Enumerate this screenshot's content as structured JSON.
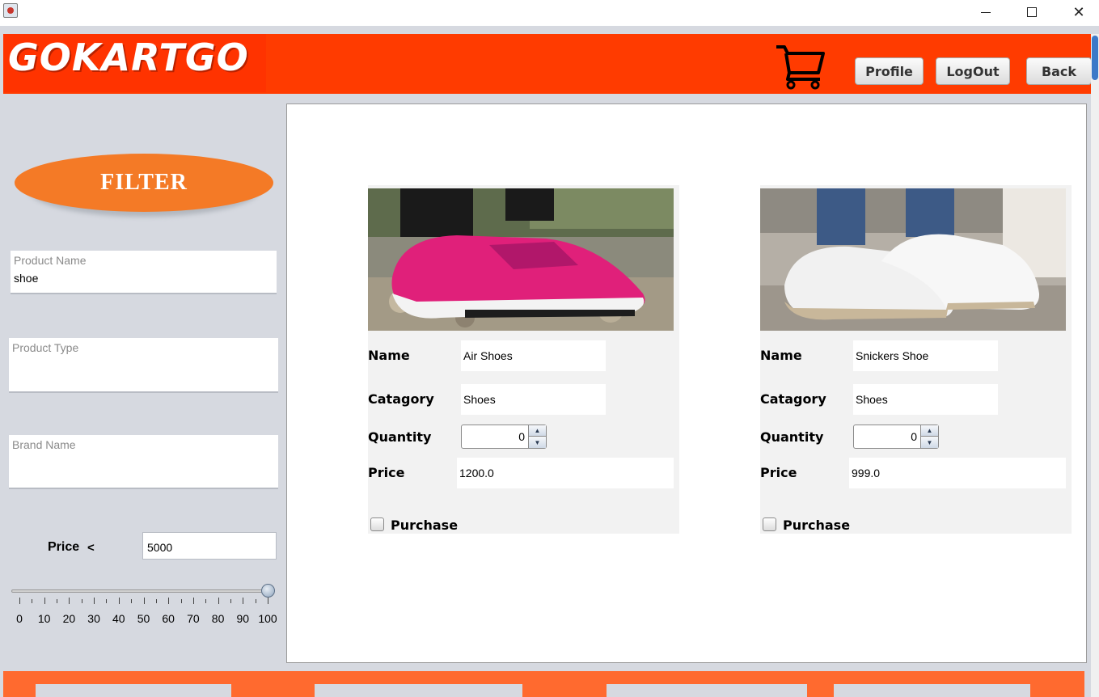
{
  "window": {
    "minimize": "",
    "maximize": "",
    "close": "✕"
  },
  "header": {
    "logo": "GOKARTGO",
    "cart_icon": "shopping-cart-icon",
    "buttons": {
      "profile": "Profile",
      "logout": "LogOut",
      "back": "Back"
    }
  },
  "sidebar": {
    "filter_label": "FILTER",
    "product_name": {
      "placeholder": "Product Name",
      "value": "shoe"
    },
    "product_type": {
      "placeholder": "Product Type",
      "value": ""
    },
    "brand_name": {
      "placeholder": "Brand Name",
      "value": ""
    },
    "price_label": "Price",
    "price_op": "<",
    "price_value": "5000",
    "slider": {
      "value": 100,
      "min": 0,
      "max": 100,
      "tick_labels": [
        "0",
        "10",
        "20",
        "30",
        "40",
        "50",
        "60",
        "70",
        "80",
        "90",
        "100"
      ]
    }
  },
  "products": [
    {
      "image": "pink-sneaker-photo",
      "name_label": "Name",
      "name": "Air Shoes",
      "category_label": "Catagory",
      "category": "Shoes",
      "quantity_label": "Quantity",
      "quantity": "0",
      "price_label": "Price",
      "price": "1200.0",
      "purchase_label": "Purchase"
    },
    {
      "image": "white-sneaker-photo",
      "name_label": "Name",
      "name": "Snickers Shoe",
      "category_label": "Catagory",
      "category": "Shoes",
      "quantity_label": "Quantity",
      "quantity": "0",
      "price_label": "Price",
      "price": "999.0",
      "purchase_label": "Purchase"
    }
  ],
  "colors": {
    "header": "#ff3b00",
    "filter_button": "#f47a26",
    "footer": "#ff6a2f",
    "frame": "#d6d9e0"
  }
}
